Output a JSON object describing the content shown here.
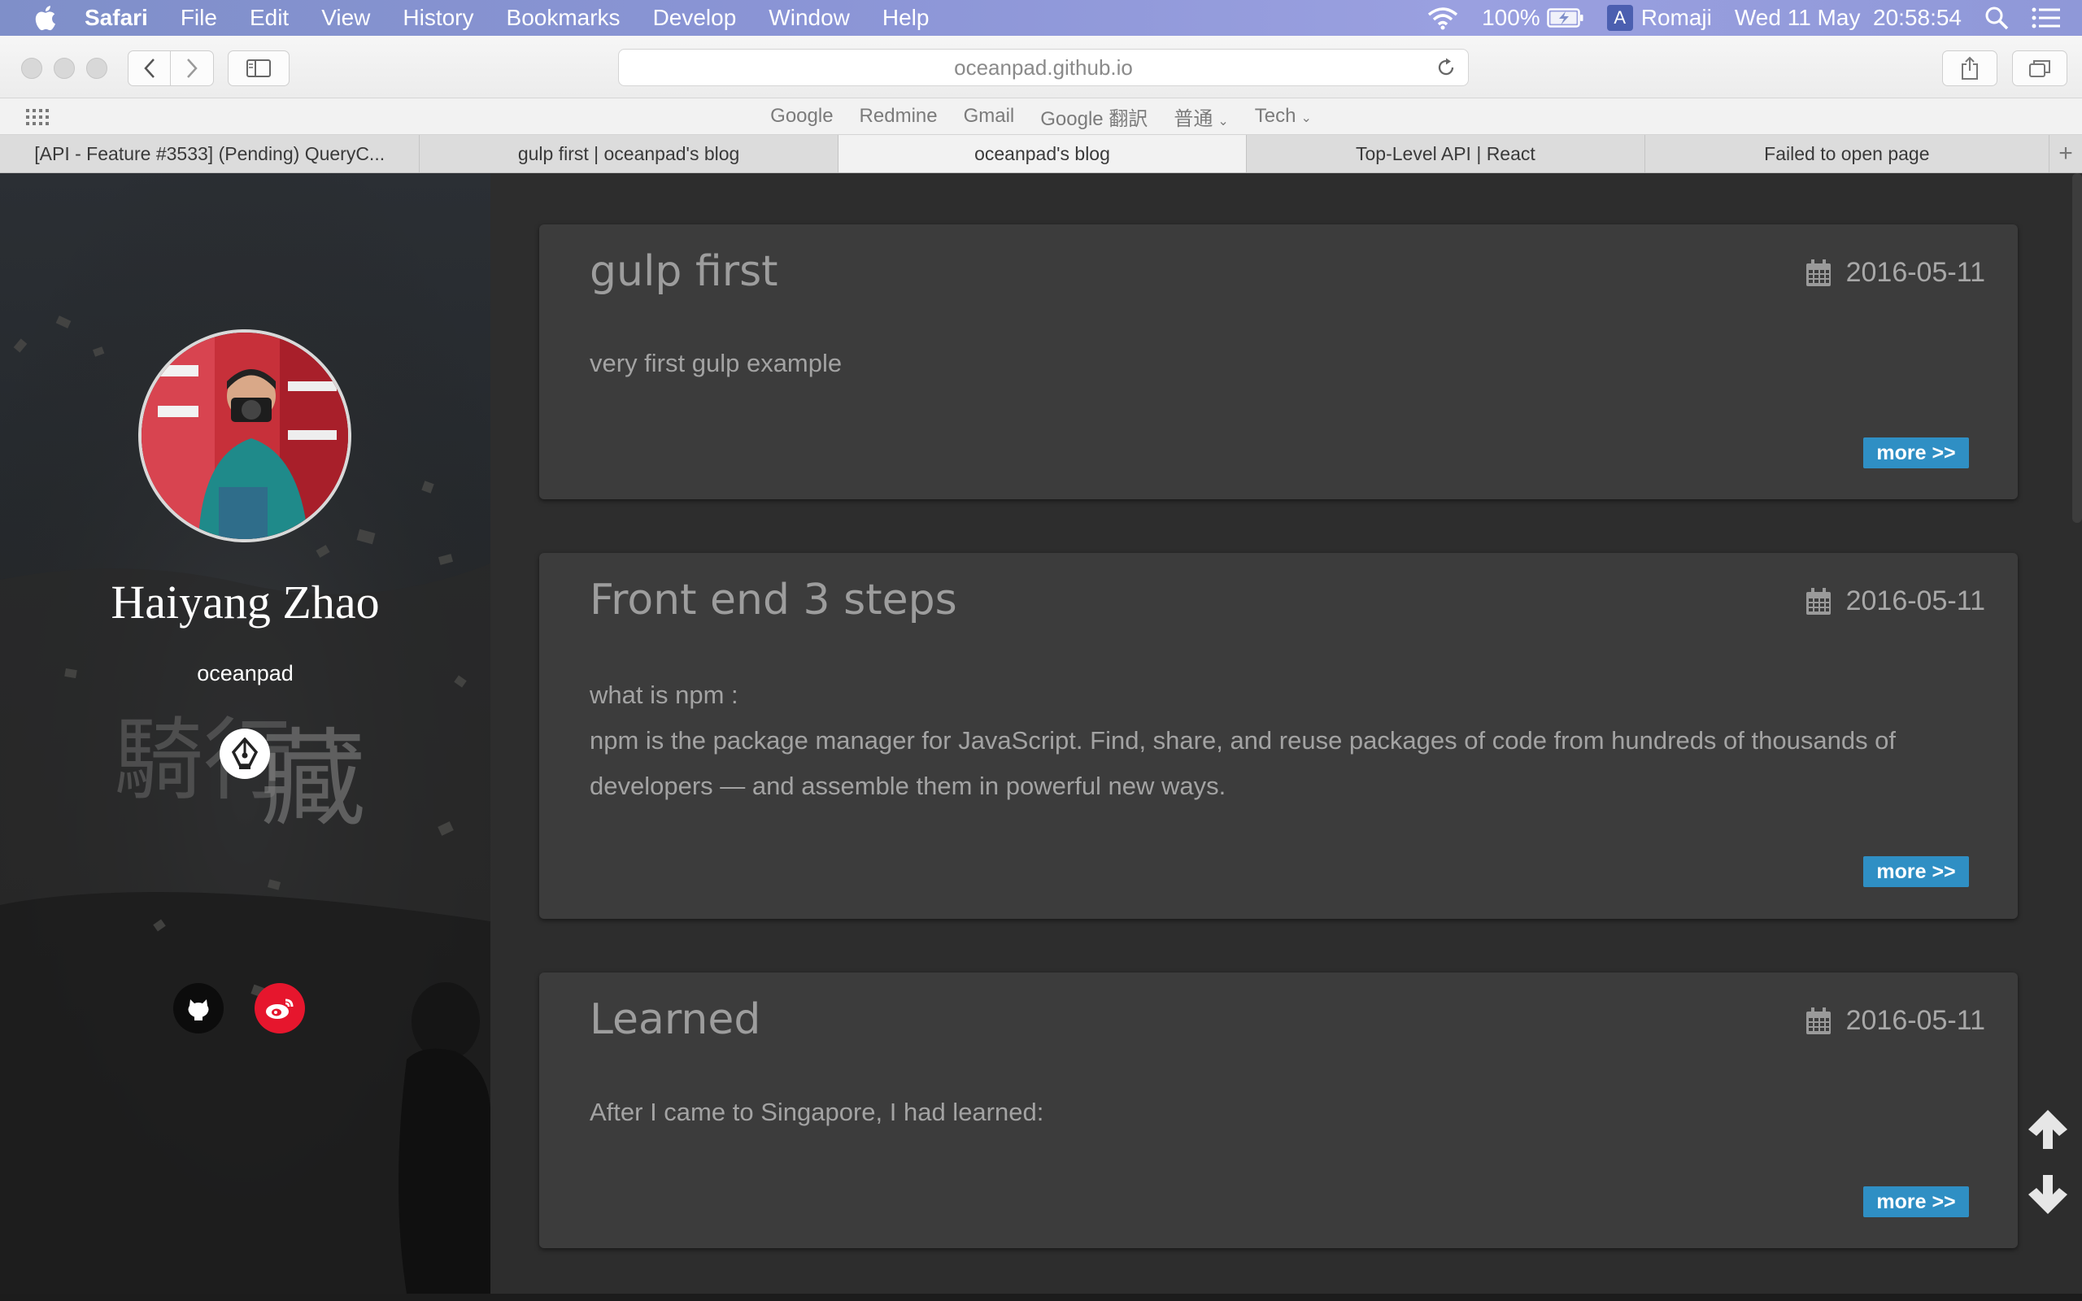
{
  "menubar": {
    "app": "Safari",
    "items": [
      "File",
      "Edit",
      "View",
      "History",
      "Bookmarks",
      "Develop",
      "Window",
      "Help"
    ],
    "battery": "100%",
    "input_method": "Romaji",
    "input_method_badge": "A",
    "clock": "Wed 11 May  20:58:54"
  },
  "browser": {
    "address": "oceanpad.github.io",
    "bookmarks": [
      "Google",
      "Redmine",
      "Gmail",
      "Google 翻訳",
      "普通",
      "Tech"
    ],
    "tabs": [
      {
        "title": "[API - Feature #3533] (Pending) QueryC...",
        "active": false
      },
      {
        "title": "gulp first | oceanpad's blog",
        "active": false
      },
      {
        "title": "oceanpad's blog",
        "active": true
      },
      {
        "title": "Top-Level API | React",
        "active": false
      },
      {
        "title": "Failed to open page",
        "active": false
      }
    ],
    "new_tab": "+"
  },
  "sidebar": {
    "name": "Haiyang Zhao",
    "handle": "oceanpad",
    "social_icons": [
      "blog-pen-icon",
      "github-icon",
      "weibo-icon"
    ]
  },
  "posts": [
    {
      "title": "gulp first",
      "date": "2016-05-11",
      "excerpt": [
        "very first gulp example"
      ],
      "more": "more >>"
    },
    {
      "title": "Front end 3 steps",
      "date": "2016-05-11",
      "excerpt": [
        "what is npm :",
        "npm is the package manager for JavaScript. Find, share, and reuse packages of code from hundreds of thousands of",
        "developers — and assemble them in powerful new ways."
      ],
      "more": "more >>"
    },
    {
      "title": "Learned",
      "date": "2016-05-11",
      "excerpt": [
        "After I came to Singapore, I had learned:"
      ],
      "more": "more >>"
    }
  ],
  "colors": {
    "accent_button": "#2f8fc4",
    "card_bg": "#3c3c3c",
    "weibo_red": "#e6162d"
  }
}
